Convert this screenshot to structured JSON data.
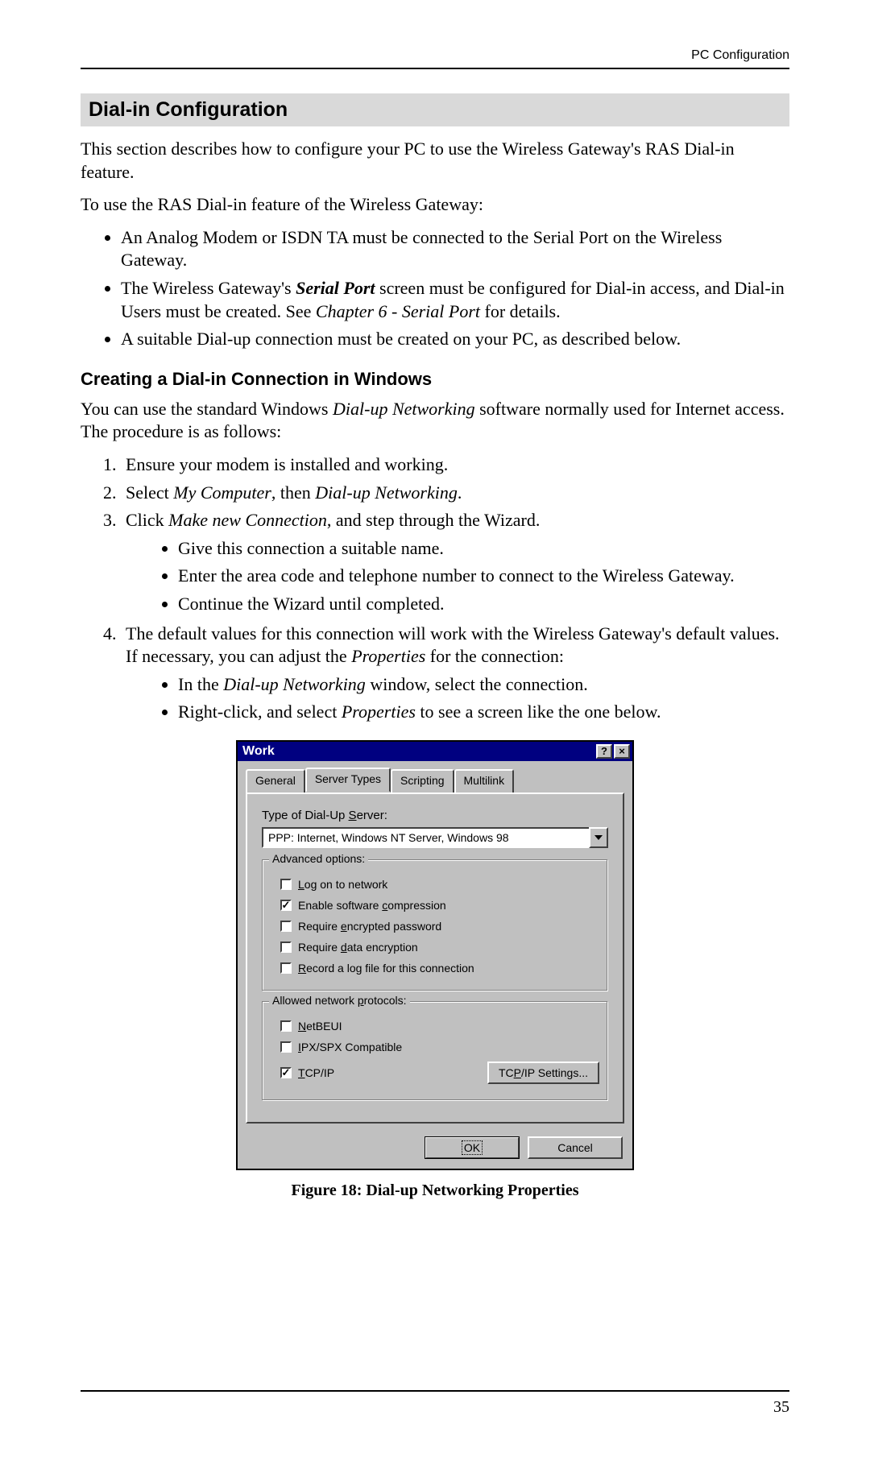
{
  "header": {
    "right": "PC Configuration"
  },
  "section_title": "Dial-in Configuration",
  "intro": "This section describes how to configure your PC to use the Wireless Gateway's RAS Dial-in feature.",
  "lead": "To use the RAS Dial-in feature of the Wireless Gateway:",
  "bullets": [
    "An Analog Modem or ISDN TA must be connected to the Serial Port on the Wireless Gateway.",
    "The Wireless Gateway's <b><i>Serial Port</i></b> screen must be configured for Dial-in access, and Dial-in Users must be created. See <i>Chapter 6 - Serial Port</i> for details.",
    "A suitable Dial-up connection must be created on your PC, as described below."
  ],
  "subheading": "Creating a Dial-in Connection in Windows",
  "sub_intro": "You can use the standard Windows <i>Dial-up Networking</i> software normally used for Internet access. The procedure is as follows:",
  "steps": {
    "s1": "Ensure your modem is installed and working.",
    "s2": "Select <i>My Computer</i>, then <i>Dial-up Networking</i>.",
    "s3": "Click <i>Make new Connection</i>, and step through the Wizard.",
    "s3_subs": [
      "Give this connection a suitable name.",
      "Enter the area code and telephone number to connect to the Wireless Gateway.",
      "Continue the Wizard until completed."
    ],
    "s4": "The default values for this connection will work with the Wireless Gateway's default values. If necessary, you can adjust the <i>Properties</i> for the connection:",
    "s4_subs": [
      "In the <i>Dial-up Networking</i> window, select the connection.",
      "Right-click, and select <i>Properties</i> to see a screen like the one below."
    ]
  },
  "dialog": {
    "title": "Work",
    "help_glyph": "?",
    "close_glyph": "×",
    "tabs": [
      "General",
      "Server Types",
      "Scripting",
      "Multilink"
    ],
    "active_tab_index": 1,
    "server_type_label": "Type of Dial-Up Server:",
    "server_type_value": "PPP: Internet, Windows NT Server, Windows 98",
    "advanced_legend": "Advanced options:",
    "adv_opts": [
      {
        "label": "Log on to network",
        "ul": "L",
        "rest": "og on to network",
        "checked": false
      },
      {
        "label": "Enable software compression",
        "pre": "Enable software ",
        "ul": "c",
        "rest": "ompression",
        "checked": true
      },
      {
        "label": "Require encrypted password",
        "pre": "Require ",
        "ul": "e",
        "rest": "ncrypted password",
        "checked": false
      },
      {
        "label": "Require data encryption",
        "pre": "Require ",
        "ul": "d",
        "rest": "ata encryption",
        "checked": false
      },
      {
        "label": "Record a log file for this connection",
        "ul": "R",
        "rest": "ecord a log file for this connection",
        "checked": false
      }
    ],
    "protocols_legend": "Allowed network protocols:",
    "protocols": [
      {
        "ul": "N",
        "rest": "etBEUI",
        "checked": false
      },
      {
        "ul": "I",
        "rest": "PX/SPX Compatible",
        "checked": false
      },
      {
        "ul": "T",
        "rest": "CP/IP",
        "checked": true
      }
    ],
    "tcpip_btn": "TCP/IP Settings...",
    "ok": "OK",
    "cancel": "Cancel"
  },
  "figure_caption": "Figure 18: Dial-up Networking Properties",
  "page_number": "35"
}
